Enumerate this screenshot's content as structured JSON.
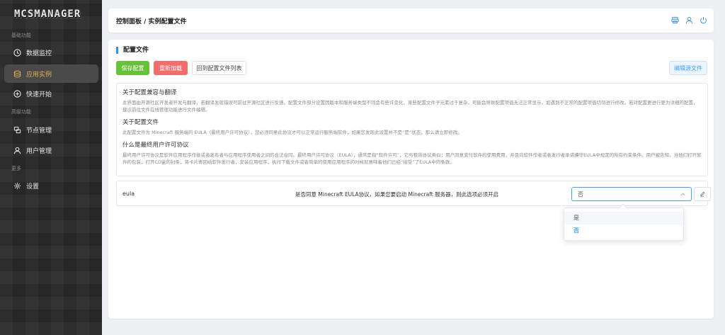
{
  "app": {
    "logo": "MCSMANAGER"
  },
  "sidebar": {
    "sections": [
      "基础功能",
      "高级功能",
      "更多"
    ],
    "items": [
      {
        "label": "数据监控",
        "icon": "dashboard-icon"
      },
      {
        "label": "应用实例",
        "icon": "database-icon"
      },
      {
        "label": "快速开始",
        "icon": "plus-circle-icon"
      },
      {
        "label": "节点管理",
        "icon": "nodes-icon"
      },
      {
        "label": "用户管理",
        "icon": "user-icon"
      },
      {
        "label": "设置",
        "icon": "gear-icon"
      }
    ]
  },
  "header": {
    "breadcrumb": "控制面板 / 实例配置文件",
    "icons": [
      "printer-icon",
      "user-icon",
      "power-icon"
    ]
  },
  "main": {
    "title": "配置文件",
    "buttons": {
      "save": "保存配置",
      "reload": "重新加载",
      "back": "回到配置文件列表",
      "edit_source": "编辑源文件"
    },
    "info": [
      {
        "heading": "关于配置兼容与翻译",
        "text": "此界面由开源社区开发者开发与翻译，若翻译发现错误可前往开源社区进行反馈。配置文件部分设置因版本和服务端类型不同会有些许变化，某些配置文件子元素过于复杂，可能会导致配置项值无法正常显示，如遇到不正常的配置项值切勿进行修改。若对配置更进行更为详细的配置，建议前往文件在线管理功能进行文件编辑。"
      },
      {
        "heading": "关于配置文件",
        "text": "此配置文件为 Minecraft 服务端的 EULA（最终用户许可协议），您必须同意此协议才可以正常运行服务端软件，如果您发现此设置并不是“是”状态，那么请立即修改。"
      },
      {
        "heading": "什么是最终用户许可协议",
        "text": "最终用户许可协议是软件应用程序作者或者发布者与应用程序使用者之间的合法合同。最终用户许可协议（EULA），通常是指“软件许可”，它与租赁协议类似；用户同意支付软件的使用费用，并且向软件作者或者发行者承诺遵守EULA中规定的所有约束条件。用户被告知，当他们打开软件的包装，打开CD盒的封条，将卡片寄回给软件发行者，安装应用程序，执行下载文件或者简单的使用应用程序的时候就意味着他们已经“接受”了EULA中的条款。"
      }
    ],
    "config_row": {
      "key": "eula",
      "description": "是否同意 Minecraft EULA协议，如果您要启动 Minecraft 服务器，则此选项必须开启",
      "selected_value": "否"
    },
    "dropdown": {
      "options": [
        "是",
        "否"
      ]
    }
  },
  "colors": {
    "accent": "#409eff",
    "save": "#67c23a",
    "reload": "#f56c6c",
    "active_nav": "#e0b04a"
  }
}
